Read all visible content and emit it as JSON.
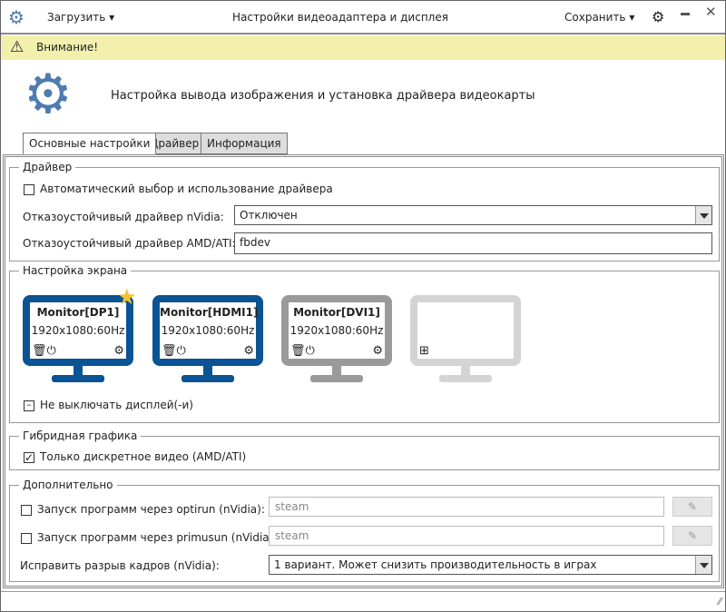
{
  "titlebar": {
    "load": "Загрузить",
    "title": "Настройки видеоадаптера и дисплея",
    "save": "Сохранить"
  },
  "warning": {
    "text": "Внимание!"
  },
  "header": {
    "text": "Настройка вывода изображения и установка драйвера видеокарты"
  },
  "tabs": [
    {
      "label": "Основные настройки",
      "active": true
    },
    {
      "label": "Драйвер"
    },
    {
      "label": "Информация"
    }
  ],
  "driver": {
    "title": "Драйвер",
    "auto": "Автоматический выбор и использование драйвера",
    "auto_checked": false,
    "nvidia_label": "Отказоустойчивый драйвер nVidia:",
    "nvidia_value": "Отключен",
    "amd_label": "Отказоустойчивый драйвер AMD/ATI:",
    "dropdown_option": "fbdev"
  },
  "screen": {
    "title": "Настройка экрана",
    "monitors": [
      {
        "name": "Monitor[DP1]",
        "res": "1920x1080:60Hz",
        "primary": true,
        "state": "active"
      },
      {
        "name": "Monitor[HDMI1]",
        "res": "1920x1080:60Hz",
        "state": "active"
      },
      {
        "name": "Monitor[DVI1]",
        "res": "1920x1080:60Hz",
        "state": "disabled"
      },
      {
        "state": "empty"
      }
    ],
    "keep_on": "Не выключать дисплей(-и)"
  },
  "hybrid": {
    "title": "Гибридная графика",
    "discrete": "Только дискретное видео (AMD/ATI)",
    "discrete_checked": true
  },
  "extra": {
    "title": "Дополнительно",
    "optirun": "Запуск программ через optirun (nVidia):",
    "optirun_value": "steam",
    "primusun": "Запуск программ через primusun (nVidia):",
    "primusun_value": "steam",
    "tearing": "Исправить разрыв кадров (nVidia):",
    "tearing_value": "1 вариант. Может снизить производительность в играх"
  },
  "colors": {
    "accent": "#0a5394",
    "gear": "#4f7bb0",
    "warning_bg": "#f3f0ad",
    "star": "#f2c12e",
    "disabled": "#9a9a9a"
  }
}
